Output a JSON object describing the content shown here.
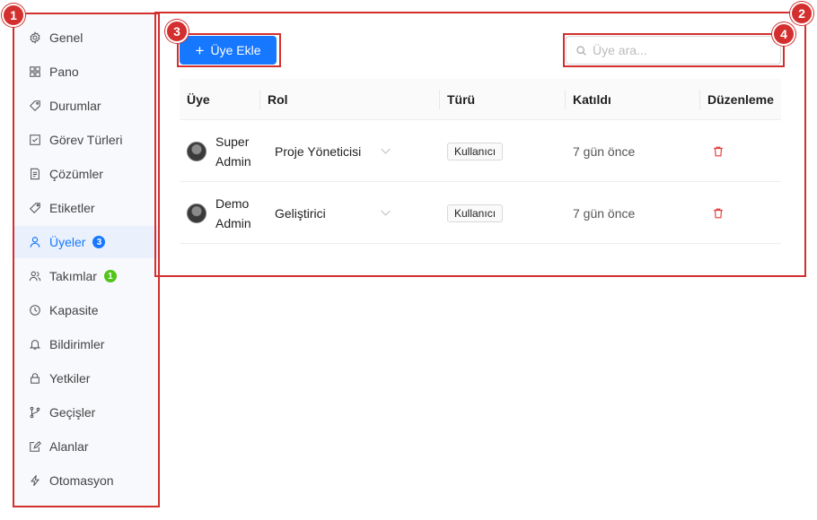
{
  "sidebar": {
    "items": [
      {
        "label": "Genel",
        "icon": "gear-icon"
      },
      {
        "label": "Pano",
        "icon": "dashboard-icon"
      },
      {
        "label": "Durumlar",
        "icon": "tag-icon"
      },
      {
        "label": "Görev Türleri",
        "icon": "checkbox-icon"
      },
      {
        "label": "Çözümler",
        "icon": "document-icon"
      },
      {
        "label": "Etiketler",
        "icon": "label-icon"
      },
      {
        "label": "Üyeler",
        "icon": "user-icon",
        "badge": "3",
        "badge_color": "#1677ff",
        "active": true
      },
      {
        "label": "Takımlar",
        "icon": "team-icon",
        "badge": "1",
        "badge_color": "#52c41a"
      },
      {
        "label": "Kapasite",
        "icon": "clock-icon"
      },
      {
        "label": "Bildirimler",
        "icon": "bell-icon"
      },
      {
        "label": "Yetkiler",
        "icon": "lock-icon"
      },
      {
        "label": "Geçişler",
        "icon": "branch-icon"
      },
      {
        "label": "Alanlar",
        "icon": "edit-icon"
      },
      {
        "label": "Otomasyon",
        "icon": "lightning-icon"
      }
    ]
  },
  "toolbar": {
    "add_label": "Üye Ekle",
    "search_placeholder": "Üye ara..."
  },
  "table": {
    "columns": [
      "Üye",
      "Rol",
      "Türü",
      "Katıldı",
      "Düzenleme"
    ],
    "rows": [
      {
        "name_line1": "Super",
        "name_line2": "Admin",
        "role": "Proje Yöneticisi",
        "type": "Kullanıcı",
        "joined": "7 gün önce"
      },
      {
        "name_line1": "Demo",
        "name_line2": "Admin",
        "role": "Geliştirici",
        "type": "Kullanıcı",
        "joined": "7 gün önce"
      }
    ]
  },
  "annotations": [
    "1",
    "2",
    "3",
    "4"
  ],
  "colors": {
    "accent": "#1677ff",
    "annotation": "#d32f2f",
    "delete": "#e53935",
    "success": "#52c41a"
  }
}
